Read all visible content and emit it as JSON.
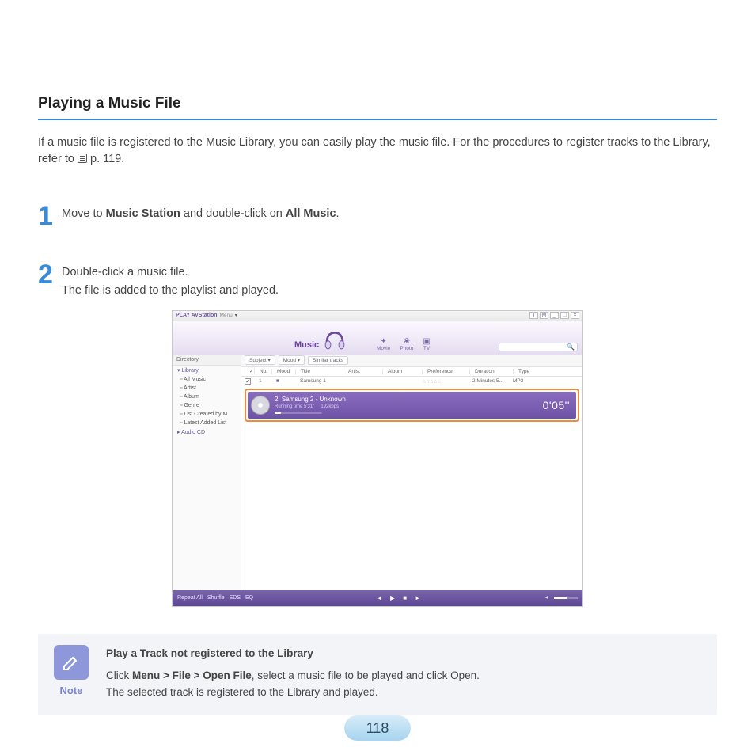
{
  "section_title": "Playing a Music File",
  "intro_a": "If a music file is registered to the Music Library, you can easily play the music file. For the procedures to register tracks to the Library, refer to ",
  "intro_b": " p. 119.",
  "steps": [
    {
      "num": "1",
      "line1a": "Move to ",
      "bold1": "Music Station",
      "line1b": " and double-click on ",
      "bold2": "All Music",
      "line1c": "."
    },
    {
      "num": "2",
      "line1": "Double-click a music file.",
      "line2": "The file is added to the playlist and played."
    }
  ],
  "app": {
    "title": "PLAY AVStation",
    "menu": "Menu",
    "win_btns": [
      "T",
      "M",
      "_",
      "□",
      "×"
    ],
    "header_label": "Music",
    "top_tabs": [
      "Movie",
      "Photo",
      "TV"
    ],
    "sidebar": {
      "header": "Directory",
      "root": "Library",
      "items": [
        "All Music",
        "Artist",
        "Album",
        "Genre",
        "List Created by M",
        "Latest Added List"
      ],
      "root2": "Audio CD"
    },
    "filters": [
      "Subject ▾",
      "Mood ▾",
      "Similar tracks"
    ],
    "columns": [
      "✓",
      "No.",
      "Mood",
      "Title",
      "Artist",
      "Album",
      "Preference",
      "Duration",
      "Type"
    ],
    "row1": {
      "no": "1",
      "mood": "■",
      "title": "Samsung 1",
      "stars": "☆☆☆☆☆",
      "dur": "2 Minutes 5...",
      "type": "MP3"
    },
    "now_playing": {
      "title": "2.  Samsung 2 - Unknown",
      "sub1": "Running time 5'31\"",
      "sub2": "192kbps",
      "time": "0'05''"
    },
    "footer": {
      "left": [
        "Repeat All",
        "Shuffle",
        "EDS",
        "EQ"
      ]
    }
  },
  "note": {
    "label": "Note",
    "title": "Play a Track not registered to the Library",
    "body_a": "Click ",
    "body_bold": "Menu > File > Open File",
    "body_b": ", select a music file to be played and click Open.",
    "body_c": "The selected track is registered to the Library and played."
  },
  "page_number": "118"
}
